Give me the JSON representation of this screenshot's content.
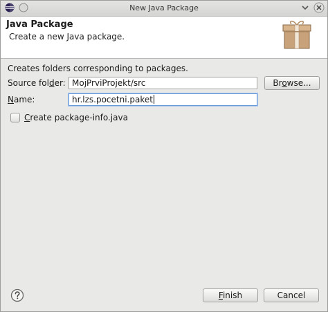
{
  "window": {
    "title": "New Java Package"
  },
  "header": {
    "title": "Java Package",
    "description": "Create a new Java package."
  },
  "form": {
    "intro": "Creates folders corresponding to packages.",
    "source_folder": {
      "label_pre": "Source fol",
      "label_mnemonic": "d",
      "label_post": "er:",
      "value": "MojPrviProjekt/src"
    },
    "browse_button": {
      "label_pre": "Br",
      "label_mnemonic": "o",
      "label_post": "wse..."
    },
    "name": {
      "label_pre": "",
      "label_mnemonic": "N",
      "label_post": "ame:",
      "value": "hr.lzs.pocetni.paket"
    },
    "package_info_checkbox": {
      "label_pre": "",
      "label_mnemonic": "C",
      "label_post": "reate package-info.java",
      "checked": false
    }
  },
  "footer": {
    "finish": {
      "label_pre": "",
      "label_mnemonic": "F",
      "label_post": "inish"
    },
    "cancel": {
      "label": "Cancel"
    }
  },
  "colors": {
    "focus_border": "#6b9ad8",
    "window_bg": "#e9e9e8"
  },
  "icons": {
    "title_app": "eclipse-icon",
    "title_menu": "circle-menu-icon",
    "minimize": "minimize-icon",
    "close": "close-icon",
    "banner": "package-icon",
    "help": "help-icon"
  }
}
